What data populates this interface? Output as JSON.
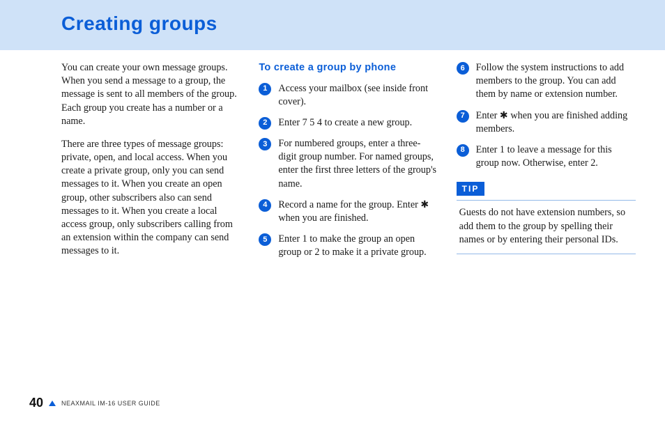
{
  "header": {
    "title": "Creating groups"
  },
  "col1": {
    "p1": "You can create your own message groups. When you send a message to a group, the message is sent to all members of the group. Each group you create has a number or a name.",
    "p2": "There are three types of message groups: private, open, and local access. When you create a private group, only you can send messages to it. When you create an open group, other subscribers also can send messages to it.  When you create a local access group, only subscribers calling from an extension within the company can send messages to it."
  },
  "col2": {
    "heading": "To create a group by phone",
    "steps": [
      "Access your mailbox (see inside front cover).",
      "Enter 7 5 4 to create a new group.",
      "For numbered groups, enter a three-digit group number. For named groups, enter the first three letters of the group's name.",
      "Record a name for the group. Enter ✱ when you are finished.",
      "Enter 1 to make the group an open group or 2 to make it a private group."
    ]
  },
  "col3": {
    "steps": [
      {
        "n": "6",
        "t": "Follow the system instructions to add members to the group. You can add them by name or extension number."
      },
      {
        "n": "7",
        "t": "Enter ✱ when you are finished adding members."
      },
      {
        "n": "8",
        "t": "Enter 1 to leave a message for this group now. Otherwise, enter 2."
      }
    ],
    "tip_label": "TIP",
    "tip_text": "Guests do not have extension numbers, so add them to the group by spelling their names or by entering their personal IDs."
  },
  "footer": {
    "page": "40",
    "guide": "NEAXMAIL IM-16 USER GUIDE"
  }
}
